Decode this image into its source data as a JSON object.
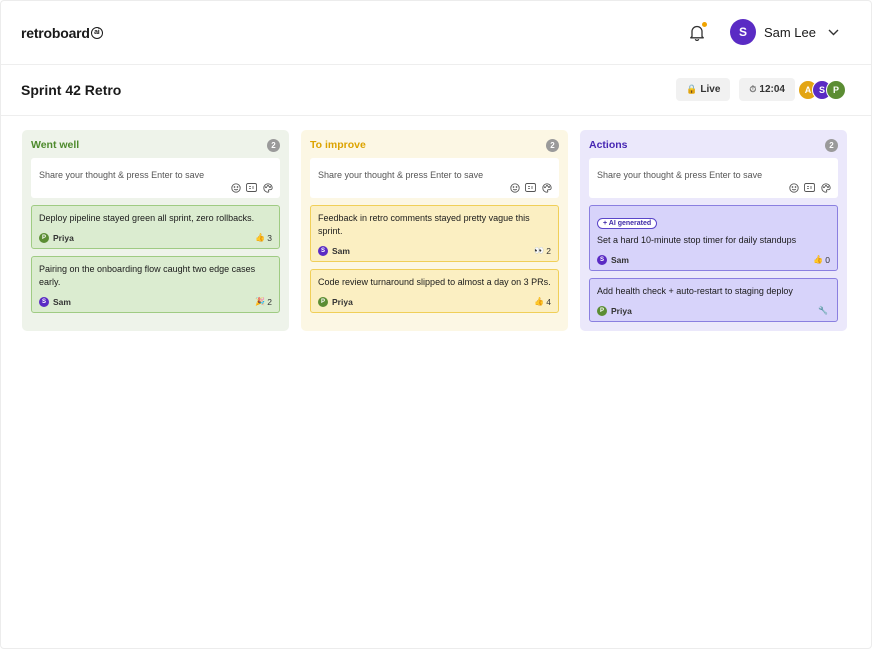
{
  "app": {
    "logo_text": "retroboard",
    "logo_badge": "ai"
  },
  "header": {
    "user": {
      "initial": "S",
      "name": "Sam Lee",
      "avatar_color": "#5a2bc4"
    },
    "notification_dot_color": "#f0a400"
  },
  "subheader": {
    "title": "Sprint 42 Retro",
    "live_label": "Live",
    "timer": "12:04",
    "participants": [
      {
        "initial": "A",
        "color": "#e3a514"
      },
      {
        "initial": "S",
        "color": "#5a2bc4"
      },
      {
        "initial": "P",
        "color": "#5b8d33"
      }
    ]
  },
  "columns": [
    {
      "id": "went-well",
      "title": "Went well",
      "count": "2",
      "accent": "#4e8a2d",
      "placeholder": "Share your thought & press Enter to save",
      "cards": [
        {
          "text": "Deploy pipeline stayed green all sprint, zero rollbacks.",
          "author": "Priya",
          "author_initial": "P",
          "author_color": "#5b8d33",
          "reaction_icon": "thumbs-up",
          "reaction_emoji": "👍",
          "reaction_count": "3"
        },
        {
          "text": "Pairing on the onboarding flow caught two edge cases early.",
          "author": "Sam",
          "author_initial": "S",
          "author_color": "#5a2bc4",
          "reaction_icon": "party-popper",
          "reaction_emoji": "🎉",
          "reaction_count": "2"
        }
      ]
    },
    {
      "id": "to-improve",
      "title": "To improve",
      "count": "2",
      "accent": "#dca300",
      "placeholder": "Share your thought & press Enter to save",
      "cards": [
        {
          "text": "Feedback in retro comments stayed pretty vague this sprint.",
          "author": "Sam",
          "author_initial": "S",
          "author_color": "#5a2bc4",
          "reaction_icon": "eyes",
          "reaction_emoji": "👀",
          "reaction_count": "2"
        },
        {
          "text": "Code review turnaround slipped to almost a day on 3 PRs.",
          "author": "Priya",
          "author_initial": "P",
          "author_color": "#5b8d33",
          "reaction_icon": "thumbs-up",
          "reaction_emoji": "👍",
          "reaction_count": "4"
        }
      ]
    },
    {
      "id": "actions",
      "title": "Actions",
      "count": "2",
      "accent": "#4727b3",
      "placeholder": "Share your thought & press Enter to save",
      "cards": [
        {
          "badge": "+ AI generated",
          "text": "Set a hard 10-minute stop timer for daily standups",
          "author": "Sam",
          "author_initial": "S",
          "author_color": "#5a2bc4",
          "reaction_icon": "thumbs-up",
          "reaction_emoji": "👍",
          "reaction_count": "0"
        },
        {
          "text": "Add health check + auto-restart to staging deploy",
          "author": "Priya",
          "author_initial": "P",
          "author_color": "#5b8d33",
          "reaction_icon": "wrench",
          "reaction_emoji": "🔧",
          "reaction_count": ""
        }
      ]
    }
  ]
}
